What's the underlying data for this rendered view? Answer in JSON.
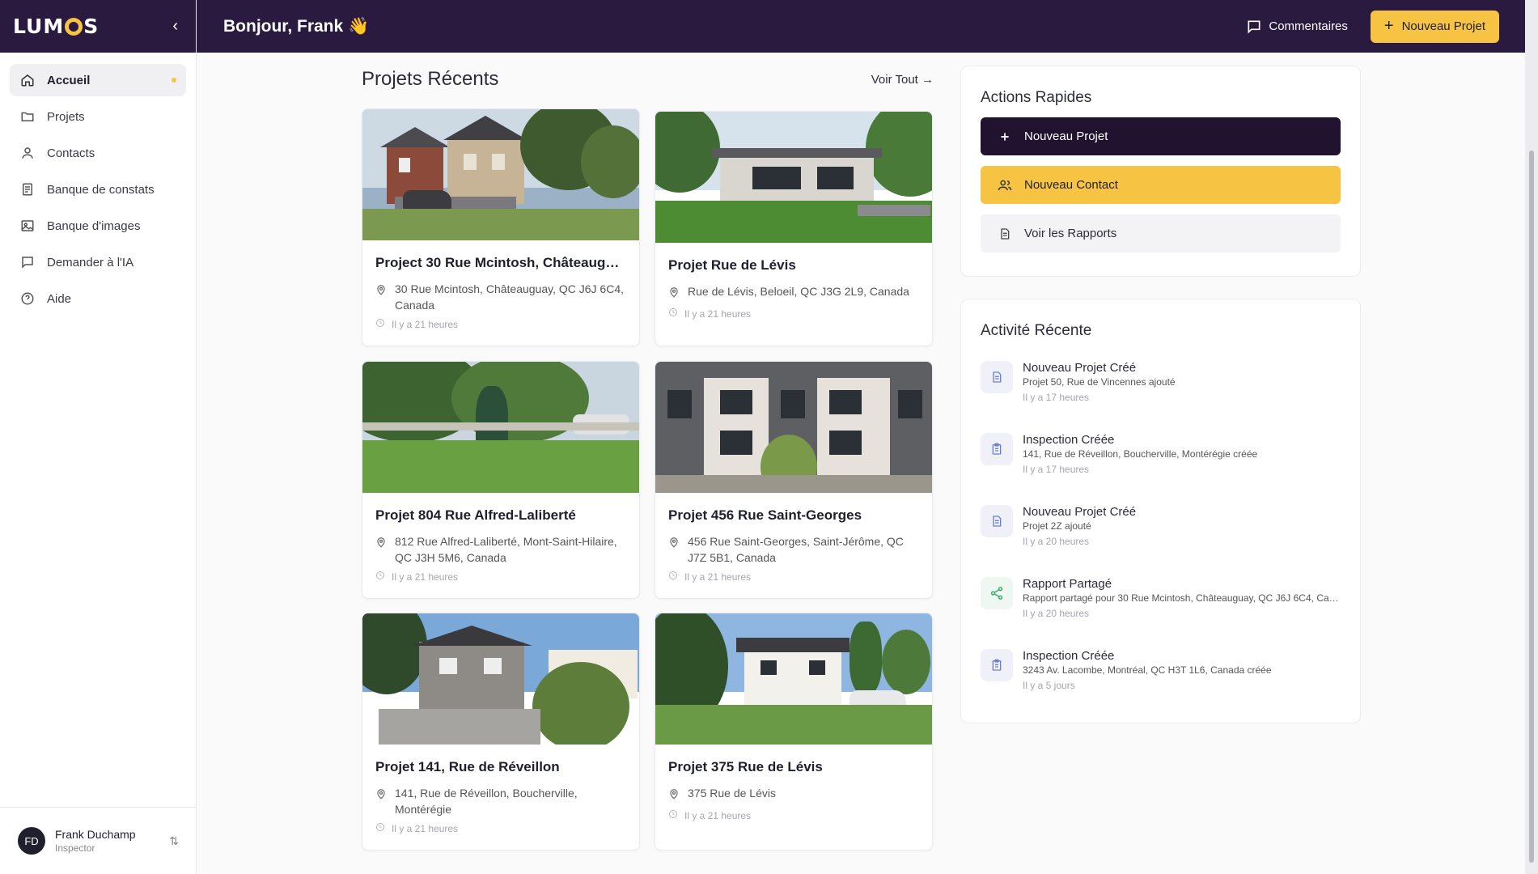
{
  "app": {
    "logo": "LUMOS",
    "greeting": "Bonjour, Frank 👋"
  },
  "header": {
    "comments_label": "Commentaires",
    "new_project_label": "Nouveau Projet"
  },
  "sidebar": {
    "items": [
      {
        "label": "Accueil",
        "icon": "home-icon"
      },
      {
        "label": "Projets",
        "icon": "folder-icon"
      },
      {
        "label": "Contacts",
        "icon": "user-icon"
      },
      {
        "label": "Banque de constats",
        "icon": "document-list-icon"
      },
      {
        "label": "Banque d'images",
        "icon": "image-icon"
      },
      {
        "label": "Demander à l'IA",
        "icon": "chat-icon"
      },
      {
        "label": "Aide",
        "icon": "help-icon"
      }
    ],
    "user": {
      "initials": "FD",
      "name": "Frank Duchamp",
      "role": "Inspector"
    }
  },
  "projects": {
    "title": "Projets Récents",
    "see_all": "Voir Tout →",
    "cards": [
      {
        "title": "Project 30 Rue Mcintosh, Châteaugua...",
        "address": "30 Rue Mcintosh, Châteauguay, QC J6J 6C4, Canada",
        "time": "Il y a 21 heures"
      },
      {
        "title": "Projet Rue de Lévis",
        "address": "Rue de Lévis, Beloeil, QC J3G 2L9, Canada",
        "time": "Il y a 21 heures"
      },
      {
        "title": "Projet 804 Rue Alfred-Laliberté",
        "address": "812 Rue Alfred-Laliberté, Mont-Saint-Hilaire, QC J3H 5M6, Canada",
        "time": "Il y a 21 heures"
      },
      {
        "title": "Projet 456 Rue Saint-Georges",
        "address": "456 Rue Saint-Georges, Saint-Jérôme, QC J7Z 5B1, Canada",
        "time": "Il y a 21 heures"
      },
      {
        "title": "Projet 141, Rue de Réveillon",
        "address": "141, Rue de Réveillon, Boucherville, Montérégie",
        "time": "Il y a 21 heures"
      },
      {
        "title": "Projet 375 Rue de Lévis",
        "address": "375 Rue de Lévis",
        "time": "Il y a 21 heures"
      }
    ]
  },
  "quick_actions": {
    "title": "Actions Rapides",
    "buttons": [
      {
        "label": "Nouveau Projet"
      },
      {
        "label": "Nouveau Contact"
      },
      {
        "label": "Voir les Rapports"
      }
    ]
  },
  "activity": {
    "title": "Activité Récente",
    "items": [
      {
        "title": "Nouveau Projet Créé",
        "desc": "Projet 50, Rue de Vincennes ajouté",
        "time": "Il y a 17 heures",
        "icon": "document-icon"
      },
      {
        "title": "Inspection Créée",
        "desc": "141, Rue de Réveillon, Boucherville, Montérégie créée",
        "time": "Il y a 17 heures",
        "icon": "clipboard-icon"
      },
      {
        "title": "Nouveau Projet Créé",
        "desc": "Projet 2Z ajouté",
        "time": "Il y a 20 heures",
        "icon": "document-icon"
      },
      {
        "title": "Rapport Partagé",
        "desc": "Rapport partagé pour 30 Rue Mcintosh, Châteauguay, QC J6J 6C4, Canada",
        "time": "Il y a 20 heures",
        "icon": "share-icon"
      },
      {
        "title": "Inspection Créée",
        "desc": "3243 Av. Lacombe, Montréal, QC H3T 1L6, Canada créée",
        "time": "Il y a 5 jours",
        "icon": "clipboard-icon"
      }
    ]
  },
  "colors": {
    "brand_dark": "#2a1a3f",
    "accent": "#f6c343",
    "activity_icon": "#6b7fd7",
    "share_icon": "#3fae6b"
  }
}
